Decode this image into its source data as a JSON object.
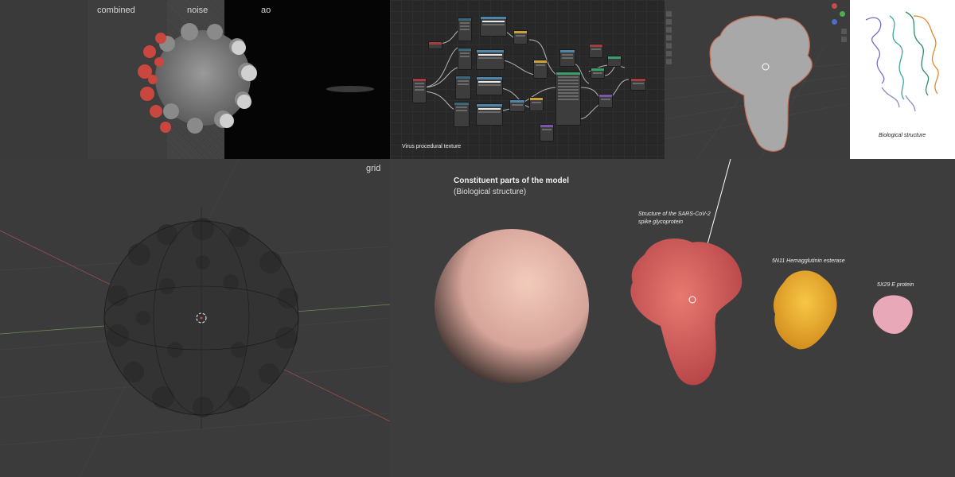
{
  "render_labels": {
    "combined": "combined",
    "noise": "noise",
    "ao": "ao",
    "grid": "grid"
  },
  "node_editor": {
    "caption": "Virus procedural texture"
  },
  "structure_panel": {
    "caption": "Biological structure"
  },
  "parts": {
    "title": "Constituent parts of the model",
    "subtitle": "(Biological structure)",
    "spike_label_line1": "Structure of the SARS-CoV-2",
    "spike_label_line2": "spike glycoprotein",
    "he_label": "5N11 Hemagglutinin esterase",
    "e_label": "5X29 E protein"
  },
  "colors": {
    "spike": "#d9645f",
    "hemagglutinin": "#f0b530",
    "e_protein": "#e8a6b6",
    "virus_body": "#e2b7a6"
  },
  "icons": [
    "3d-cursor-icon",
    "toolbar-icons"
  ]
}
